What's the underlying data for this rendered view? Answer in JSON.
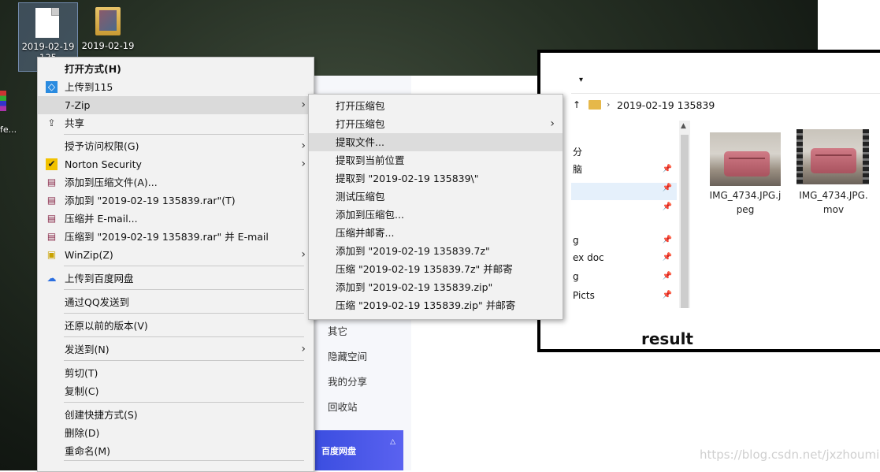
{
  "desktop": {
    "icons": [
      {
        "label": "2019-02-19\n135",
        "kind": "file-icon"
      },
      {
        "label": "2019-02-19",
        "kind": "folder-icon"
      }
    ],
    "left_edge_text": "fe..."
  },
  "baidu": {
    "items": [
      "其它",
      "隐藏空间",
      "我的分享",
      "回收站"
    ],
    "banner_logo": "百度网盘",
    "banner_mark": "△"
  },
  "context_menu": {
    "items": [
      {
        "label": "打开方式(H)",
        "icon": "",
        "bold": true
      },
      {
        "label": "上传到115",
        "icon": "cloud-115-icon"
      },
      {
        "label": "7-Zip",
        "icon": "",
        "submenu": true,
        "highlighted": true
      },
      {
        "label": "共享",
        "icon": "share-icon"
      },
      {
        "label": "授予访问权限(G)",
        "icon": "",
        "submenu": true
      },
      {
        "label": "Norton Security",
        "icon": "norton-check-icon",
        "submenu": true
      },
      {
        "label": "添加到压缩文件(A)...",
        "icon": "winrar-icon"
      },
      {
        "label": "添加到 \"2019-02-19 135839.rar\"(T)",
        "icon": "winrar-icon"
      },
      {
        "label": "压缩并 E-mail...",
        "icon": "winrar-icon"
      },
      {
        "label": "压缩到 \"2019-02-19 135839.rar\" 并 E-mail",
        "icon": "winrar-icon"
      },
      {
        "label": "WinZip(Z)",
        "icon": "winzip-icon",
        "submenu": true
      },
      {
        "label": "上传到百度网盘",
        "icon": "baidu-cloud-icon"
      },
      {
        "label": "通过QQ发送到",
        "icon": ""
      },
      {
        "label": "还原以前的版本(V)",
        "icon": ""
      },
      {
        "label": "发送到(N)",
        "icon": "",
        "submenu": true
      },
      {
        "label": "剪切(T)",
        "icon": ""
      },
      {
        "label": "复制(C)",
        "icon": ""
      },
      {
        "label": "创建快捷方式(S)",
        "icon": ""
      },
      {
        "label": "删除(D)",
        "icon": ""
      },
      {
        "label": "重命名(M)",
        "icon": ""
      }
    ],
    "submenu_arrow": "›"
  },
  "sevenzip_submenu": {
    "items": [
      {
        "label": "打开压缩包"
      },
      {
        "label": "打开压缩包",
        "submenu": true
      },
      {
        "label": "提取文件...",
        "highlighted": true
      },
      {
        "label": "提取到当前位置"
      },
      {
        "label": "提取到 \"2019-02-19 135839\\\""
      },
      {
        "label": "测试压缩包"
      },
      {
        "label": "添加到压缩包..."
      },
      {
        "label": "压缩并邮寄..."
      },
      {
        "label": "添加到 \"2019-02-19 135839.7z\""
      },
      {
        "label": "压缩 \"2019-02-19 135839.7z\" 并邮寄"
      },
      {
        "label": "添加到 \"2019-02-19 135839.zip\""
      },
      {
        "label": "压缩 \"2019-02-19 135839.zip\" 并邮寄"
      }
    ]
  },
  "explorer": {
    "qa_glyph": "▾",
    "up_glyph": "↑",
    "address_sep": "›",
    "address": "2019-02-19 135839",
    "nav_items": [
      "分",
      "脑",
      "",
      "",
      "g",
      "ex doc",
      "g",
      "Picts"
    ],
    "pin_glyph": "📌",
    "files": [
      {
        "name_line1": "IMG_4734.JPG.j",
        "name_line2": "peg",
        "type": "photo"
      },
      {
        "name_line1": "IMG_4734.JPG.",
        "name_line2": "mov",
        "type": "video"
      }
    ],
    "scroll_up": "▲",
    "result_label": "result"
  },
  "watermark": "https://blog.csdn.net/jxzhoumin",
  "colors": {
    "highlight": "#dadada",
    "folder": "#e6b84a",
    "baidu_blue": "#3b4ee0"
  }
}
